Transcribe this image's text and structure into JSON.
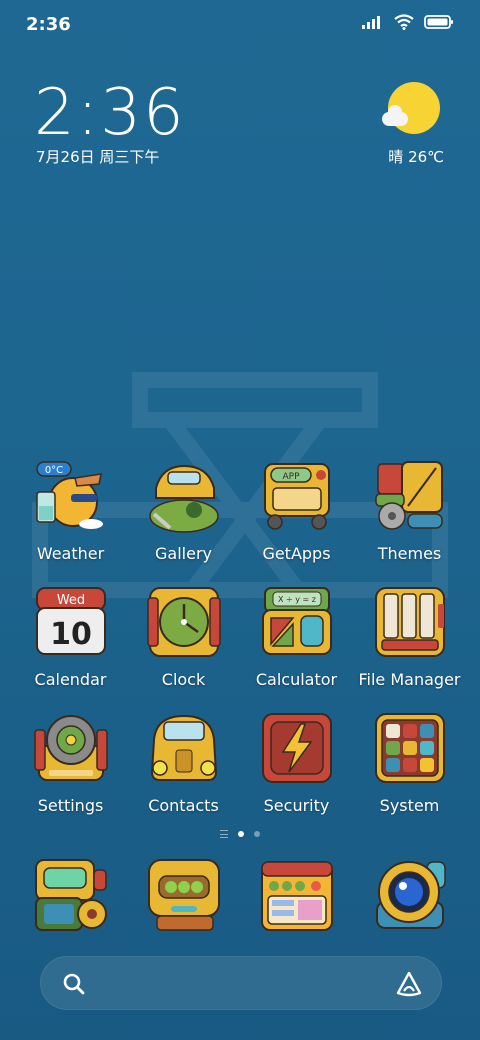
{
  "status_bar": {
    "time": "2:36",
    "signal_icon": "signal-bars-icon",
    "wifi_icon": "wifi-icon",
    "battery_icon": "battery-icon"
  },
  "clock_widget": {
    "time": "2:36",
    "date": "7月26日 周三下午"
  },
  "weather_widget": {
    "icon": "sun-cloud-icon",
    "text": "晴 26℃"
  },
  "apps": [
    [
      {
        "label": "Weather",
        "badge": "0°C"
      },
      {
        "label": "Gallery"
      },
      {
        "label": "GetApps",
        "icon_text": "APP"
      },
      {
        "label": "Themes"
      }
    ],
    [
      {
        "label": "Calendar",
        "weekday": "Wed",
        "day": "10"
      },
      {
        "label": "Clock"
      },
      {
        "label": "Calculator",
        "icon_text": "X ÷ y = z"
      },
      {
        "label": "File Manager"
      }
    ],
    [
      {
        "label": "Settings"
      },
      {
        "label": "Contacts"
      },
      {
        "label": "Security"
      },
      {
        "label": "System"
      }
    ]
  ],
  "dock": [
    {
      "name": "phone"
    },
    {
      "name": "messages"
    },
    {
      "name": "browser"
    },
    {
      "name": "camera"
    }
  ],
  "search": {
    "icon": "search-icon",
    "assistant_icon": "assistant-icon"
  },
  "colors": {
    "background": "#1d6690",
    "sun": "#f7d433",
    "icon_yellow": "#e8b733",
    "icon_red": "#c7473a",
    "icon_green": "#6ea84a",
    "outline": "#3a2a1e"
  }
}
